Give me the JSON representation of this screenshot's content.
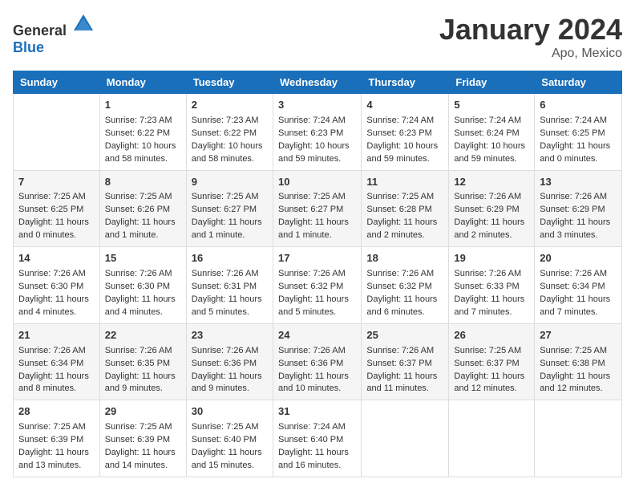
{
  "header": {
    "logo_general": "General",
    "logo_blue": "Blue",
    "month_year": "January 2024",
    "location": "Apo, Mexico"
  },
  "days_of_week": [
    "Sunday",
    "Monday",
    "Tuesday",
    "Wednesday",
    "Thursday",
    "Friday",
    "Saturday"
  ],
  "weeks": [
    [
      {
        "day": "",
        "content": ""
      },
      {
        "day": "1",
        "content": "Sunrise: 7:23 AM\nSunset: 6:22 PM\nDaylight: 10 hours\nand 58 minutes."
      },
      {
        "day": "2",
        "content": "Sunrise: 7:23 AM\nSunset: 6:22 PM\nDaylight: 10 hours\nand 58 minutes."
      },
      {
        "day": "3",
        "content": "Sunrise: 7:24 AM\nSunset: 6:23 PM\nDaylight: 10 hours\nand 59 minutes."
      },
      {
        "day": "4",
        "content": "Sunrise: 7:24 AM\nSunset: 6:23 PM\nDaylight: 10 hours\nand 59 minutes."
      },
      {
        "day": "5",
        "content": "Sunrise: 7:24 AM\nSunset: 6:24 PM\nDaylight: 10 hours\nand 59 minutes."
      },
      {
        "day": "6",
        "content": "Sunrise: 7:24 AM\nSunset: 6:25 PM\nDaylight: 11 hours\nand 0 minutes."
      }
    ],
    [
      {
        "day": "7",
        "content": "Sunrise: 7:25 AM\nSunset: 6:25 PM\nDaylight: 11 hours\nand 0 minutes."
      },
      {
        "day": "8",
        "content": "Sunrise: 7:25 AM\nSunset: 6:26 PM\nDaylight: 11 hours\nand 1 minute."
      },
      {
        "day": "9",
        "content": "Sunrise: 7:25 AM\nSunset: 6:27 PM\nDaylight: 11 hours\nand 1 minute."
      },
      {
        "day": "10",
        "content": "Sunrise: 7:25 AM\nSunset: 6:27 PM\nDaylight: 11 hours\nand 1 minute."
      },
      {
        "day": "11",
        "content": "Sunrise: 7:25 AM\nSunset: 6:28 PM\nDaylight: 11 hours\nand 2 minutes."
      },
      {
        "day": "12",
        "content": "Sunrise: 7:26 AM\nSunset: 6:29 PM\nDaylight: 11 hours\nand 2 minutes."
      },
      {
        "day": "13",
        "content": "Sunrise: 7:26 AM\nSunset: 6:29 PM\nDaylight: 11 hours\nand 3 minutes."
      }
    ],
    [
      {
        "day": "14",
        "content": "Sunrise: 7:26 AM\nSunset: 6:30 PM\nDaylight: 11 hours\nand 4 minutes."
      },
      {
        "day": "15",
        "content": "Sunrise: 7:26 AM\nSunset: 6:30 PM\nDaylight: 11 hours\nand 4 minutes."
      },
      {
        "day": "16",
        "content": "Sunrise: 7:26 AM\nSunset: 6:31 PM\nDaylight: 11 hours\nand 5 minutes."
      },
      {
        "day": "17",
        "content": "Sunrise: 7:26 AM\nSunset: 6:32 PM\nDaylight: 11 hours\nand 5 minutes."
      },
      {
        "day": "18",
        "content": "Sunrise: 7:26 AM\nSunset: 6:32 PM\nDaylight: 11 hours\nand 6 minutes."
      },
      {
        "day": "19",
        "content": "Sunrise: 7:26 AM\nSunset: 6:33 PM\nDaylight: 11 hours\nand 7 minutes."
      },
      {
        "day": "20",
        "content": "Sunrise: 7:26 AM\nSunset: 6:34 PM\nDaylight: 11 hours\nand 7 minutes."
      }
    ],
    [
      {
        "day": "21",
        "content": "Sunrise: 7:26 AM\nSunset: 6:34 PM\nDaylight: 11 hours\nand 8 minutes."
      },
      {
        "day": "22",
        "content": "Sunrise: 7:26 AM\nSunset: 6:35 PM\nDaylight: 11 hours\nand 9 minutes."
      },
      {
        "day": "23",
        "content": "Sunrise: 7:26 AM\nSunset: 6:36 PM\nDaylight: 11 hours\nand 9 minutes."
      },
      {
        "day": "24",
        "content": "Sunrise: 7:26 AM\nSunset: 6:36 PM\nDaylight: 11 hours\nand 10 minutes."
      },
      {
        "day": "25",
        "content": "Sunrise: 7:26 AM\nSunset: 6:37 PM\nDaylight: 11 hours\nand 11 minutes."
      },
      {
        "day": "26",
        "content": "Sunrise: 7:25 AM\nSunset: 6:37 PM\nDaylight: 11 hours\nand 12 minutes."
      },
      {
        "day": "27",
        "content": "Sunrise: 7:25 AM\nSunset: 6:38 PM\nDaylight: 11 hours\nand 12 minutes."
      }
    ],
    [
      {
        "day": "28",
        "content": "Sunrise: 7:25 AM\nSunset: 6:39 PM\nDaylight: 11 hours\nand 13 minutes."
      },
      {
        "day": "29",
        "content": "Sunrise: 7:25 AM\nSunset: 6:39 PM\nDaylight: 11 hours\nand 14 minutes."
      },
      {
        "day": "30",
        "content": "Sunrise: 7:25 AM\nSunset: 6:40 PM\nDaylight: 11 hours\nand 15 minutes."
      },
      {
        "day": "31",
        "content": "Sunrise: 7:24 AM\nSunset: 6:40 PM\nDaylight: 11 hours\nand 16 minutes."
      },
      {
        "day": "",
        "content": ""
      },
      {
        "day": "",
        "content": ""
      },
      {
        "day": "",
        "content": ""
      }
    ]
  ]
}
